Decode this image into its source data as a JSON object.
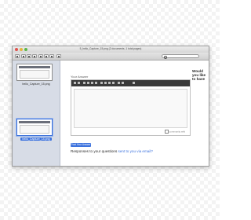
{
  "window": {
    "title": "5_hello_Capture_15.png (2 documents, 1 total pages)"
  },
  "toolbar": {
    "search_placeholder": ""
  },
  "sidebar": {
    "items": [
      {
        "label": "hello_Capture_15.png",
        "selected": false
      },
      {
        "label": "hello_Capture_14.png",
        "selected": true
      }
    ]
  },
  "content": {
    "answer_label": "Your Answer",
    "side_question": "Would you like to have",
    "post_button": "Post Your Answer",
    "responses_text": "Responses to your questions ",
    "responses_link": "sent to you via email?",
    "editor_checkbox_label": "community wiki"
  },
  "colors": {
    "accent": "#3d73de",
    "sidebar_bg": "#d7dce6",
    "editor_toolbar": "#3a3a3a"
  }
}
